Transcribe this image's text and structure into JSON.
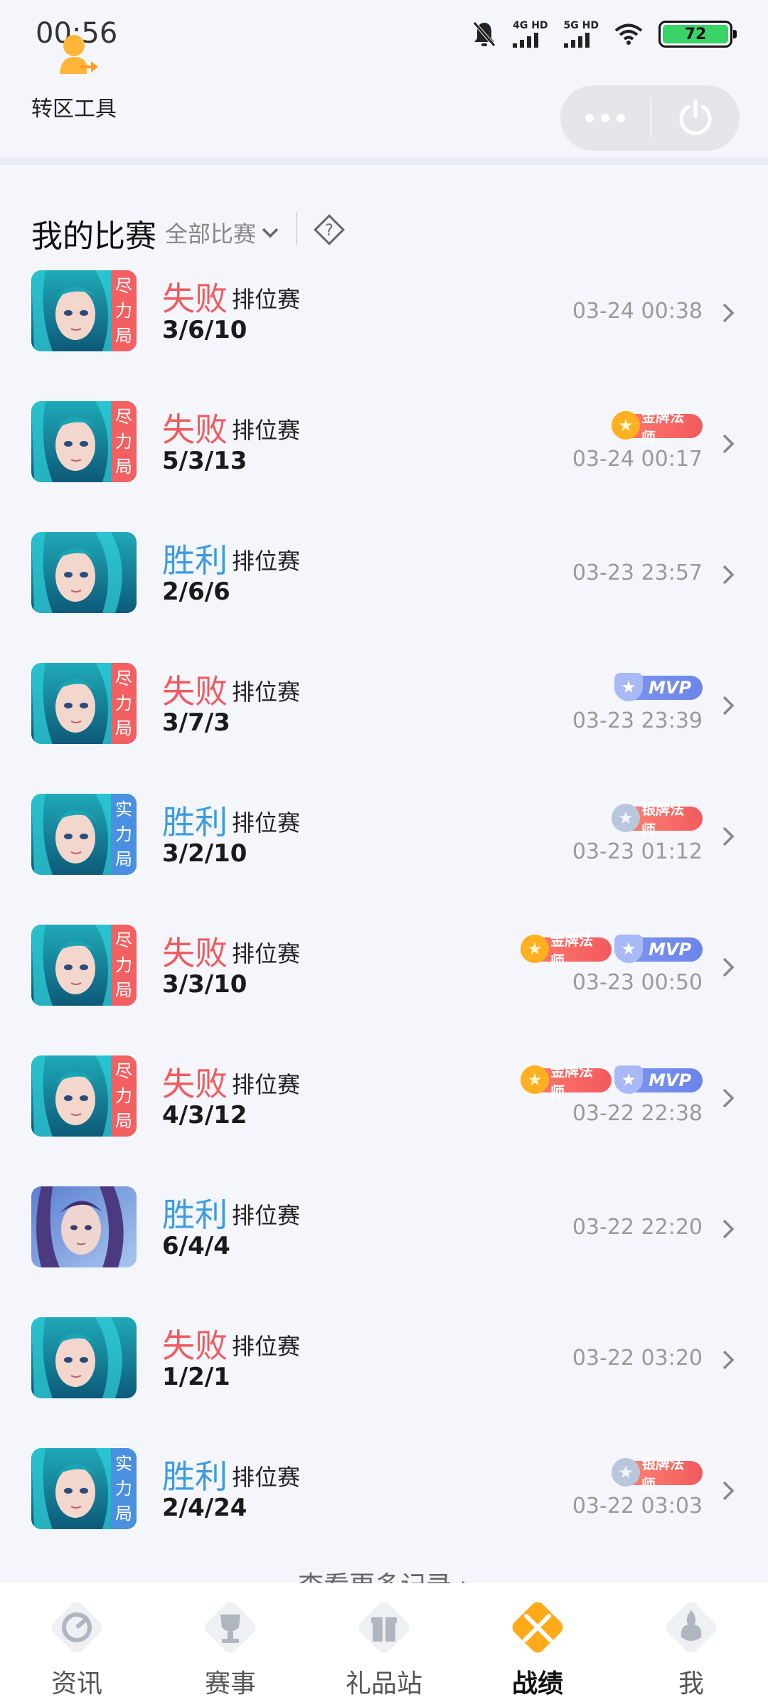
{
  "status_bar": {
    "time": "00:56",
    "net1": "4G HD",
    "net2": "5G HD",
    "battery": "72"
  },
  "top": {
    "tool_label": "转区工具"
  },
  "section": {
    "title": "我的比赛",
    "filter": "全部比赛"
  },
  "matches": [
    {
      "result": "失败",
      "outcome": "loss",
      "mode": "排位赛",
      "kda": "3/6/10",
      "time": "03-24 00:38",
      "tag": [
        "尽",
        "力",
        "局"
      ],
      "tag_color": "red",
      "hero": "a",
      "badges": []
    },
    {
      "result": "失败",
      "outcome": "loss",
      "mode": "排位赛",
      "kda": "5/3/13",
      "time": "03-24 00:17",
      "tag": [
        "尽",
        "力",
        "局"
      ],
      "tag_color": "red",
      "hero": "a",
      "badges": [
        "gold"
      ]
    },
    {
      "result": "胜利",
      "outcome": "win",
      "mode": "排位赛",
      "kda": "2/6/6",
      "time": "03-23 23:57",
      "tag": [],
      "tag_color": "",
      "hero": "a",
      "badges": []
    },
    {
      "result": "失败",
      "outcome": "loss",
      "mode": "排位赛",
      "kda": "3/7/3",
      "time": "03-23 23:39",
      "tag": [
        "尽",
        "力",
        "局"
      ],
      "tag_color": "red",
      "hero": "a",
      "badges": [
        "mvp"
      ]
    },
    {
      "result": "胜利",
      "outcome": "win",
      "mode": "排位赛",
      "kda": "3/2/10",
      "time": "03-23 01:12",
      "tag": [
        "实",
        "力",
        "局"
      ],
      "tag_color": "blue",
      "hero": "a",
      "badges": [
        "silver"
      ]
    },
    {
      "result": "失败",
      "outcome": "loss",
      "mode": "排位赛",
      "kda": "3/3/10",
      "time": "03-23 00:50",
      "tag": [
        "尽",
        "力",
        "局"
      ],
      "tag_color": "red",
      "hero": "a",
      "badges": [
        "gold",
        "mvp"
      ]
    },
    {
      "result": "失败",
      "outcome": "loss",
      "mode": "排位赛",
      "kda": "4/3/12",
      "time": "03-22 22:38",
      "tag": [
        "尽",
        "力",
        "局"
      ],
      "tag_color": "red",
      "hero": "a",
      "badges": [
        "gold",
        "mvp"
      ]
    },
    {
      "result": "胜利",
      "outcome": "win",
      "mode": "排位赛",
      "kda": "6/4/4",
      "time": "03-22 22:20",
      "tag": [],
      "tag_color": "",
      "hero": "b",
      "badges": []
    },
    {
      "result": "失败",
      "outcome": "loss",
      "mode": "排位赛",
      "kda": "1/2/1",
      "time": "03-22 03:20",
      "tag": [],
      "tag_color": "",
      "hero": "a",
      "badges": []
    },
    {
      "result": "胜利",
      "outcome": "win",
      "mode": "排位赛",
      "kda": "2/4/24",
      "time": "03-22 03:03",
      "tag": [
        "实",
        "力",
        "局"
      ],
      "tag_color": "blue",
      "hero": "a",
      "badges": [
        "silver"
      ]
    }
  ],
  "badge_text": {
    "gold": "金牌法师",
    "silver": "银牌法师",
    "mvp": "MVP"
  },
  "more_records": "查看更多记录 ›",
  "nav": [
    {
      "label": "资讯",
      "icon": "news-icon",
      "active": false
    },
    {
      "label": "赛事",
      "icon": "trophy-icon",
      "active": false
    },
    {
      "label": "礼品站",
      "icon": "gift-icon",
      "active": false
    },
    {
      "label": "战绩",
      "icon": "battle-record-icon",
      "active": true
    },
    {
      "label": "我",
      "icon": "profile-icon",
      "active": false
    }
  ],
  "colors": {
    "loss": "#f25a5e",
    "win": "#3d9ce0",
    "active_nav": "#ffab19"
  }
}
